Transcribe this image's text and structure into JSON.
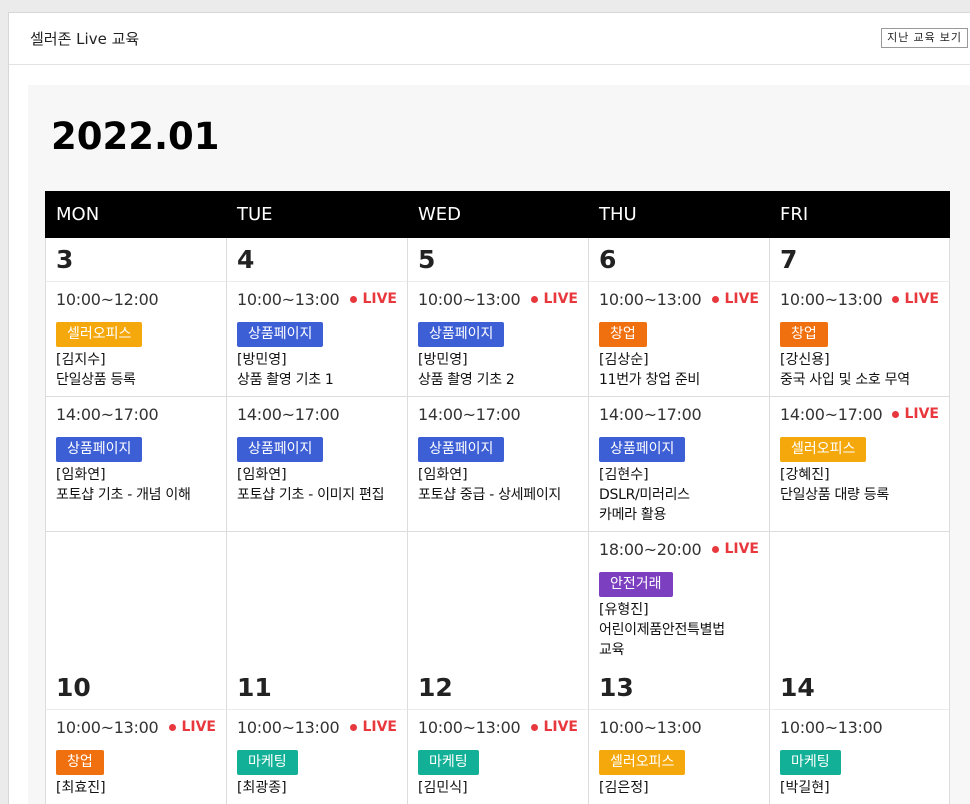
{
  "header": {
    "title": "셀러존 Live 교육",
    "past_button": "지난 교육 보기"
  },
  "calendar": {
    "month": "2022.01",
    "weekdays": [
      "MON",
      "TUE",
      "WED",
      "THU",
      "FRI"
    ],
    "live_label": "LIVE",
    "colors": {
      "셀러오피스": "#f5a80c",
      "상품페이지": "#3d5fd6",
      "창업": "#f0700f",
      "안전거래": "#7b3fbf",
      "마케팅": "#12b097",
      "live": "#e8383d"
    },
    "weeks": [
      {
        "dates": [
          "3",
          "4",
          "5",
          "6",
          "7"
        ],
        "rows": [
          [
            {
              "time": "10:00~12:00",
              "live": false,
              "tag": "셀러오피스",
              "instructor": "[김지수]",
              "title": [
                "단일상품 등록"
              ]
            },
            {
              "time": "10:00~13:00",
              "live": true,
              "tag": "상품페이지",
              "instructor": "[방민영]",
              "title": [
                "상품 촬영 기초 1"
              ]
            },
            {
              "time": "10:00~13:00",
              "live": true,
              "tag": "상품페이지",
              "instructor": "[방민영]",
              "title": [
                "상품 촬영 기초 2"
              ]
            },
            {
              "time": "10:00~13:00",
              "live": true,
              "tag": "창업",
              "instructor": "[김상순]",
              "title": [
                "11번가 창업 준비"
              ]
            },
            {
              "time": "10:00~13:00",
              "live": true,
              "tag": "창업",
              "instructor": "[강신용]",
              "title": [
                "중국 사입 및 소호 무역"
              ]
            }
          ],
          [
            {
              "time": "14:00~17:00",
              "live": false,
              "tag": "상품페이지",
              "instructor": "[임화연]",
              "title": [
                "포토샵 기초 - 개념 이해"
              ]
            },
            {
              "time": "14:00~17:00",
              "live": false,
              "tag": "상품페이지",
              "instructor": "[임화연]",
              "title": [
                "포토샵 기초 - 이미지 편집"
              ]
            },
            {
              "time": "14:00~17:00",
              "live": false,
              "tag": "상품페이지",
              "instructor": "[임화연]",
              "title": [
                "포토샵 중급 - 상세페이지"
              ]
            },
            {
              "time": "14:00~17:00",
              "live": false,
              "tag": "상품페이지",
              "instructor": "[김현수]",
              "title": [
                "DSLR/미러리스",
                "카메라 활용"
              ]
            },
            {
              "time": "14:00~17:00",
              "live": true,
              "tag": "셀러오피스",
              "instructor": "[강혜진]",
              "title": [
                "단일상품 대량 등록"
              ]
            }
          ],
          [
            null,
            null,
            null,
            {
              "time": "18:00~20:00",
              "live": true,
              "tag": "안전거래",
              "instructor": "[유형진]",
              "title": [
                "어린이제품안전특별법",
                "교육"
              ]
            },
            null
          ]
        ]
      },
      {
        "dates": [
          "10",
          "11",
          "12",
          "13",
          "14"
        ],
        "rows": [
          [
            {
              "time": "10:00~13:00",
              "live": true,
              "tag": "창업",
              "instructor": "[최효진]",
              "title": []
            },
            {
              "time": "10:00~13:00",
              "live": true,
              "tag": "마케팅",
              "instructor": "[최광종]",
              "title": []
            },
            {
              "time": "10:00~13:00",
              "live": true,
              "tag": "마케팅",
              "instructor": "[김민식]",
              "title": []
            },
            {
              "time": "10:00~13:00",
              "live": false,
              "tag": "셀러오피스",
              "instructor": "[김은정]",
              "title": []
            },
            {
              "time": "10:00~13:00",
              "live": false,
              "tag": "마케팅",
              "instructor": "[박길현]",
              "title": []
            }
          ]
        ]
      }
    ]
  }
}
